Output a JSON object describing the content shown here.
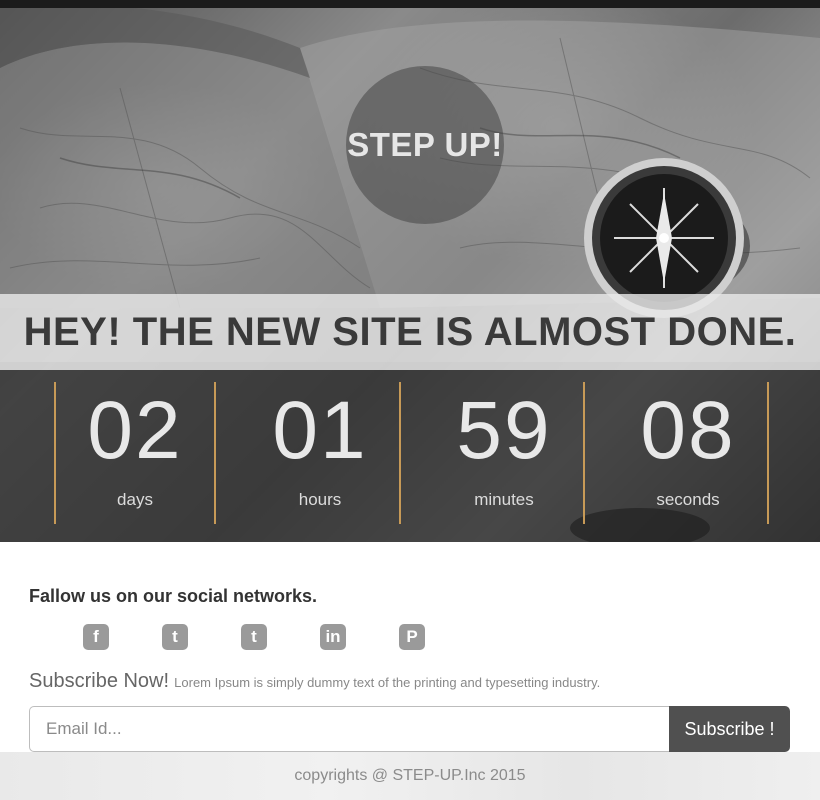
{
  "hero": {
    "logo": "STEP UP!",
    "headline": "HEY! THE NEW SITE IS ALMOST DONE."
  },
  "countdown": [
    {
      "value": "02",
      "label": "days"
    },
    {
      "value": "01",
      "label": "hours"
    },
    {
      "value": "59",
      "label": "minutes"
    },
    {
      "value": "08",
      "label": "seconds"
    }
  ],
  "social": {
    "heading": "Fallow us on our social networks.",
    "icons": [
      {
        "name": "facebook-icon",
        "glyph": "f"
      },
      {
        "name": "twitter-icon",
        "glyph": "t"
      },
      {
        "name": "tumblr-icon",
        "glyph": "t"
      },
      {
        "name": "linkedin-icon",
        "glyph": "in"
      },
      {
        "name": "pinterest-icon",
        "glyph": "P"
      }
    ]
  },
  "subscribe": {
    "title": "Subscribe Now!",
    "description": "Lorem Ipsum is simply dummy text of the printing and typesetting industry.",
    "email_placeholder": "Email Id...",
    "button_label": "Subscribe !"
  },
  "footer": {
    "copyright": "copyrights @ STEP-UP.Inc 2015"
  },
  "colors": {
    "accent_separator": "#c79a57",
    "button_bg": "#505050"
  }
}
